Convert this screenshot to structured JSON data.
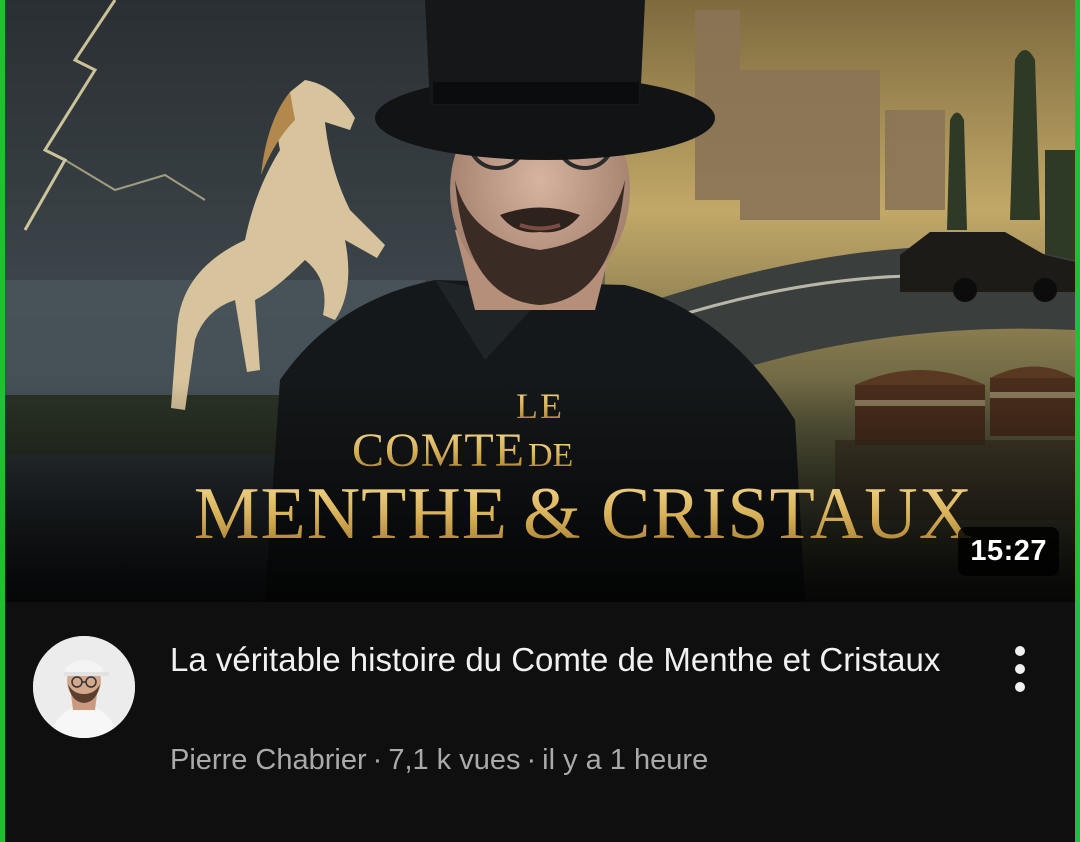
{
  "thumbnail": {
    "title_line_1": "LE",
    "title_line_2_a": "COMTE",
    "title_line_2_b": "DE",
    "title_line_3_a": "MENTHE",
    "title_line_3_b": "& CRISTAUX",
    "duration": "15:27"
  },
  "video": {
    "title": "La véritable histoire du Comte de Menthe et Cristaux",
    "channel": "Pierre Chabrier",
    "separator": "·",
    "views": "7,1 k vues",
    "age": "il y a 1 heure"
  },
  "colors": {
    "frame_border": "#1fbf3a",
    "background": "#0f0f0f",
    "title_text": "#f1f1f1",
    "meta_text": "#aaaaaa",
    "gold": "#d9b25a"
  },
  "icons": {
    "more": "more-vert-icon"
  }
}
